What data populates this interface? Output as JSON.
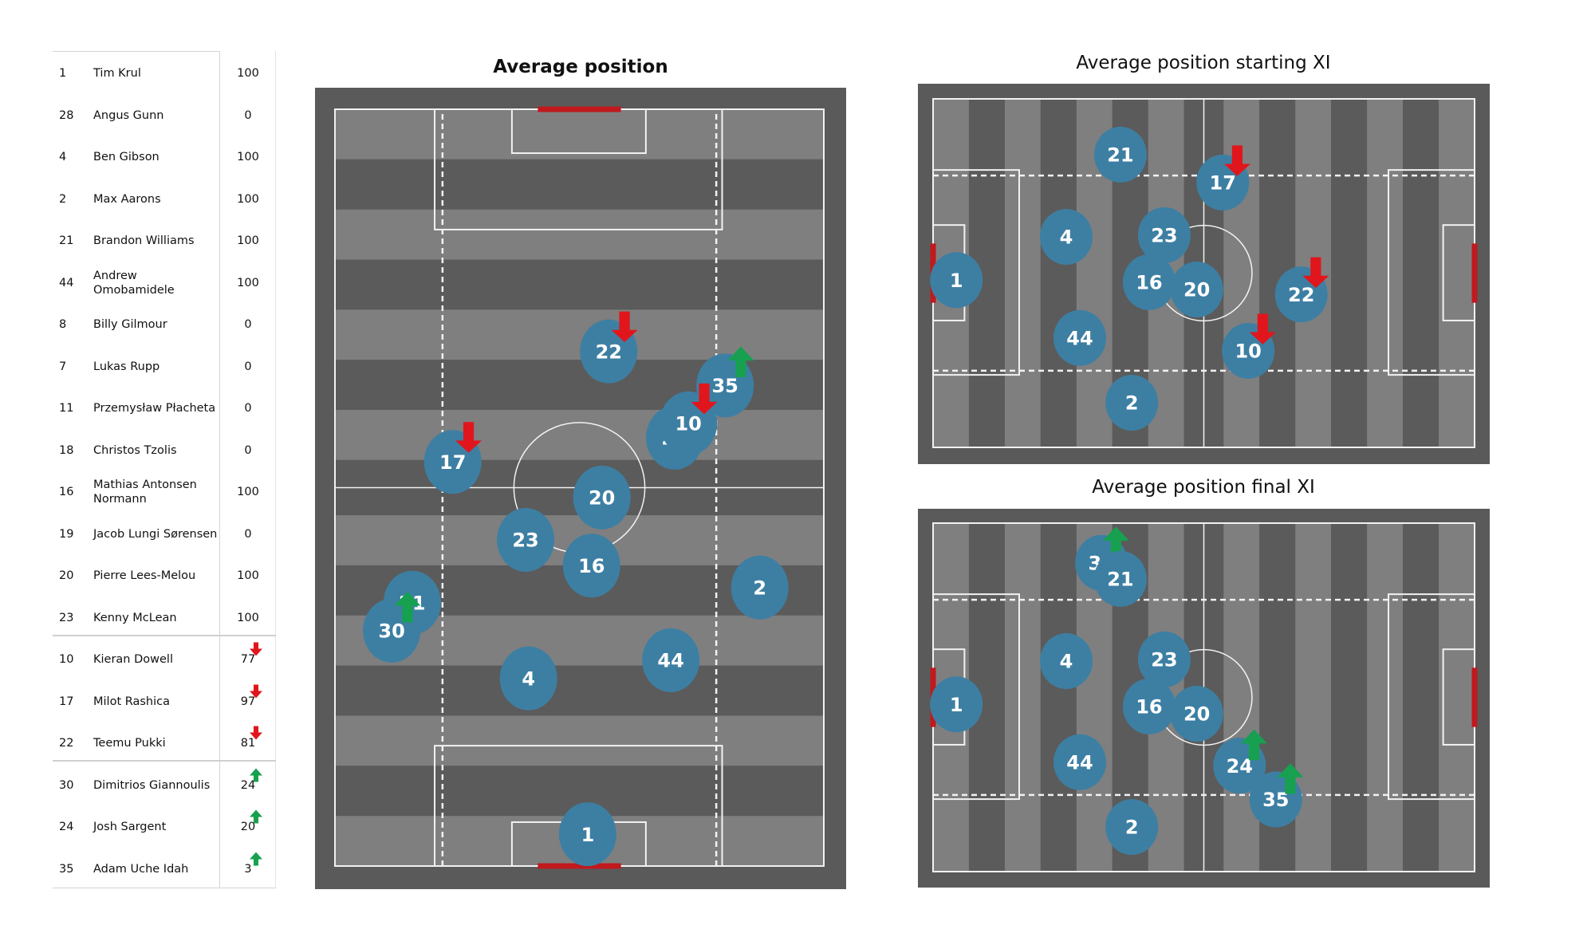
{
  "colors": {
    "frame": "#5a5a5a",
    "stripe_light": "#7f7f7f",
    "stripe_dark": "#5b5b5b",
    "line": "#f2f2f2",
    "goal": "#c0191e",
    "player": "#3d7fa3",
    "arrow_off": "#e0161c",
    "arrow_on": "#16a050"
  },
  "table": {
    "rows": [
      {
        "number": "1",
        "name": "Tim Krul",
        "value": "100",
        "change": null
      },
      {
        "number": "28",
        "name": "Angus Gunn",
        "value": "0",
        "change": null
      },
      {
        "number": "4",
        "name": "Ben Gibson",
        "value": "100",
        "change": null
      },
      {
        "number": "2",
        "name": "Max Aarons",
        "value": "100",
        "change": null
      },
      {
        "number": "21",
        "name": "Brandon Williams",
        "value": "100",
        "change": null
      },
      {
        "number": "44",
        "name": "Andrew Omobamidele",
        "value": "100",
        "change": null
      },
      {
        "number": "8",
        "name": "Billy Gilmour",
        "value": "0",
        "change": null
      },
      {
        "number": "7",
        "name": "Lukas Rupp",
        "value": "0",
        "change": null
      },
      {
        "number": "11",
        "name": "Przemysław Płacheta",
        "value": "0",
        "change": null
      },
      {
        "number": "18",
        "name": "Christos Tzolis",
        "value": "0",
        "change": null
      },
      {
        "number": "16",
        "name": "Mathias  Antonsen Normann",
        "value": "100",
        "change": null
      },
      {
        "number": "19",
        "name": "Jacob  Lungi Sørensen",
        "value": "0",
        "change": null
      },
      {
        "number": "20",
        "name": "Pierre Lees-Melou",
        "value": "100",
        "change": null
      },
      {
        "number": "23",
        "name": "Kenny McLean",
        "value": "100",
        "change": null
      },
      {
        "number": "10",
        "name": "Kieran Dowell",
        "value": "77",
        "change": "off"
      },
      {
        "number": "17",
        "name": "Milot Rashica",
        "value": "97",
        "change": "off"
      },
      {
        "number": "22",
        "name": "Teemu Pukki",
        "value": "81",
        "change": "off"
      },
      {
        "number": "30",
        "name": "Dimitrios Giannoulis",
        "value": "24",
        "change": "on"
      },
      {
        "number": "24",
        "name": "Josh Sargent",
        "value": "20",
        "change": "on"
      },
      {
        "number": "35",
        "name": "Adam Uche Idah",
        "value": "3",
        "change": "on"
      }
    ]
  },
  "chart_data": [
    {
      "type": "scatter",
      "title": "Average position",
      "orientation": "vertical",
      "xlabel": "",
      "ylabel": "",
      "pitch_units": "percent of pitch length (from own goal) / width",
      "points": [
        {
          "label": "22",
          "length": 68.0,
          "width": 56.0,
          "marker": "off"
        },
        {
          "label": "35",
          "length": 63.5,
          "width": 79.8,
          "marker": "on"
        },
        {
          "label": "24",
          "length": 56.6,
          "width": 69.5,
          "marker": "on"
        },
        {
          "label": "10",
          "length": 58.5,
          "width": 72.3,
          "marker": "off"
        },
        {
          "label": "17",
          "length": 53.4,
          "width": 24.1,
          "marker": "off"
        },
        {
          "label": "20",
          "length": 48.7,
          "width": 54.6,
          "marker": null
        },
        {
          "label": "23",
          "length": 43.1,
          "width": 39.0,
          "marker": null
        },
        {
          "label": "16",
          "length": 39.7,
          "width": 52.5,
          "marker": null
        },
        {
          "label": "2",
          "length": 36.8,
          "width": 86.9,
          "marker": null
        },
        {
          "label": "21",
          "length": 34.8,
          "width": 15.8,
          "marker": null
        },
        {
          "label": "30",
          "length": 31.1,
          "width": 11.6,
          "marker": "on"
        },
        {
          "label": "4",
          "length": 24.8,
          "width": 39.6,
          "marker": null
        },
        {
          "label": "44",
          "length": 27.2,
          "width": 68.7,
          "marker": null
        },
        {
          "label": "1",
          "length": 4.2,
          "width": 51.7,
          "marker": null
        }
      ]
    },
    {
      "type": "scatter",
      "title": "Average position starting XI",
      "orientation": "horizontal",
      "xlabel": "",
      "ylabel": "",
      "points": [
        {
          "label": "21",
          "length": 34.6,
          "width": 16.0,
          "marker": null
        },
        {
          "label": "17",
          "length": 53.5,
          "width": 24.0,
          "marker": "off"
        },
        {
          "label": "4",
          "length": 24.6,
          "width": 39.6,
          "marker": null
        },
        {
          "label": "23",
          "length": 42.7,
          "width": 39.1,
          "marker": null
        },
        {
          "label": "1",
          "length": 4.3,
          "width": 52.0,
          "marker": null
        },
        {
          "label": "16",
          "length": 39.9,
          "width": 52.6,
          "marker": null
        },
        {
          "label": "20",
          "length": 48.7,
          "width": 54.7,
          "marker": null
        },
        {
          "label": "22",
          "length": 68.0,
          "width": 56.1,
          "marker": "off"
        },
        {
          "label": "44",
          "length": 27.1,
          "width": 68.6,
          "marker": null
        },
        {
          "label": "10",
          "length": 58.2,
          "width": 72.3,
          "marker": "off"
        },
        {
          "label": "2",
          "length": 36.7,
          "width": 87.2,
          "marker": null
        }
      ]
    },
    {
      "type": "scatter",
      "title": "Average position final XI",
      "orientation": "horizontal",
      "xlabel": "",
      "ylabel": "",
      "points": [
        {
          "label": "30",
          "length": 31.1,
          "width": 11.4,
          "marker": "on"
        },
        {
          "label": "21",
          "length": 34.6,
          "width": 16.0,
          "marker": null
        },
        {
          "label": "4",
          "length": 24.6,
          "width": 39.6,
          "marker": null
        },
        {
          "label": "23",
          "length": 42.7,
          "width": 39.1,
          "marker": null
        },
        {
          "label": "1",
          "length": 4.3,
          "width": 52.0,
          "marker": null
        },
        {
          "label": "16",
          "length": 39.9,
          "width": 52.6,
          "marker": null
        },
        {
          "label": "20",
          "length": 48.7,
          "width": 54.7,
          "marker": null
        },
        {
          "label": "44",
          "length": 27.1,
          "width": 68.6,
          "marker": null
        },
        {
          "label": "24",
          "length": 56.6,
          "width": 69.6,
          "marker": "on"
        },
        {
          "label": "35",
          "length": 63.3,
          "width": 79.3,
          "marker": "on"
        },
        {
          "label": "2",
          "length": 36.7,
          "width": 87.2,
          "marker": null
        }
      ]
    }
  ]
}
